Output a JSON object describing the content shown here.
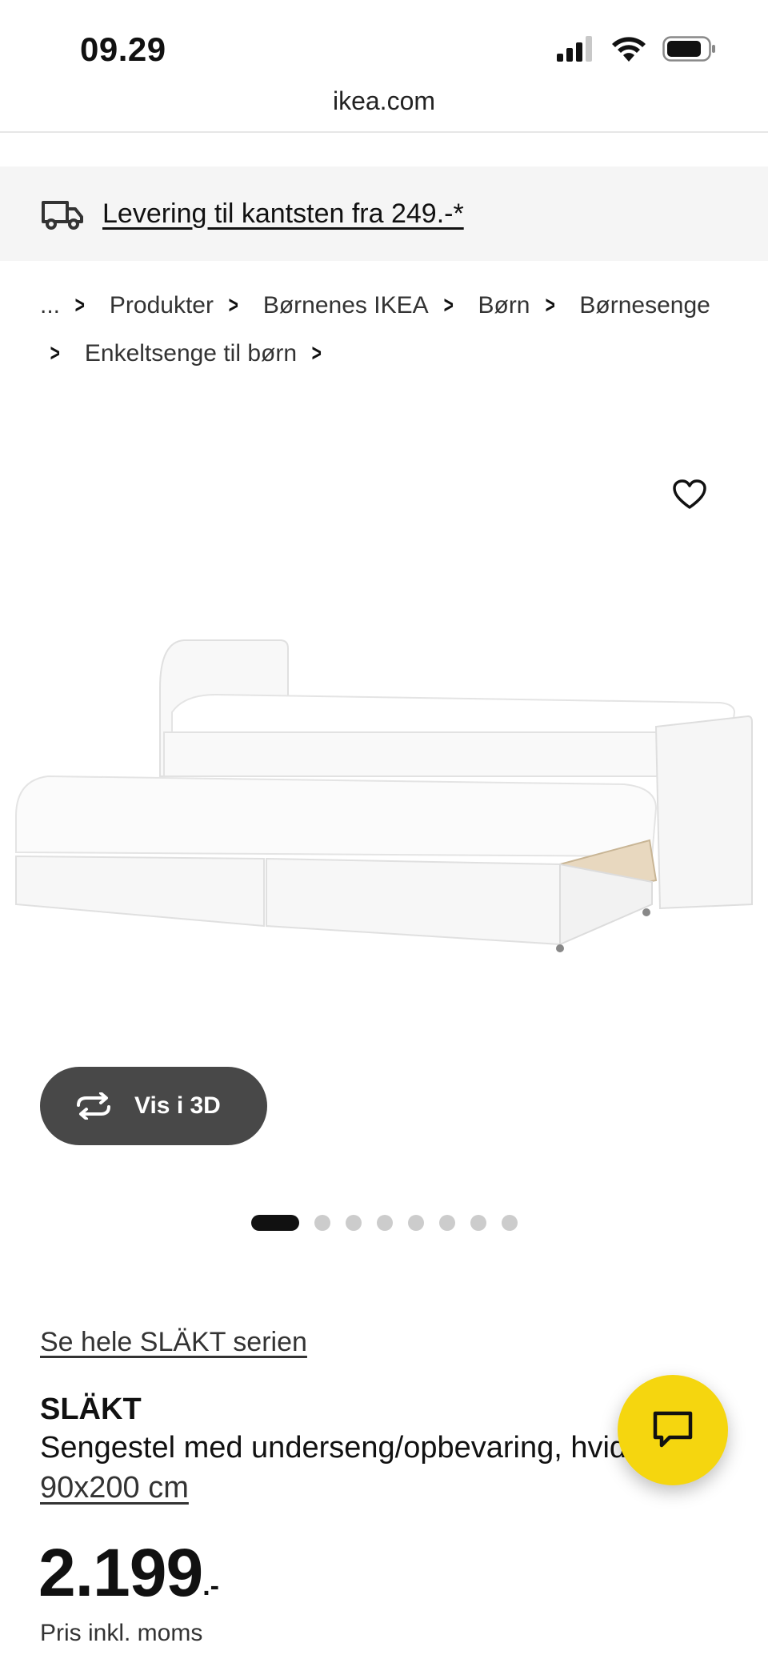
{
  "status_bar": {
    "time": "09.29"
  },
  "browser": {
    "url": "ikea.com"
  },
  "delivery_banner": {
    "text": "Levering til kantsten fra 249.-*",
    "icon": "truck-icon"
  },
  "breadcrumb": {
    "items": [
      "...",
      "Produkter",
      "Børnenes IKEA",
      "Børn",
      "Børnesenge",
      "Enkeltsenge til børn"
    ]
  },
  "favorite": {
    "icon": "heart-icon"
  },
  "view_3d": {
    "label": "Vis i 3D",
    "icon": "rotate-3d-icon"
  },
  "carousel": {
    "total": 8,
    "active_index": 0
  },
  "product": {
    "series_link": "Se hele SLÄKT serien",
    "name": "SLÄKT",
    "description": "Sengestel med underseng/opbevaring, hvid,",
    "size": "90x200 cm",
    "price_integer": "2.199",
    "price_suffix": ".-",
    "vat_note": "Pris inkl. moms"
  },
  "chat": {
    "icon": "chat-bubble-icon"
  },
  "colors": {
    "accent_yellow": "#f5d60f",
    "button_dark": "#484848",
    "banner_bg": "#f5f5f5"
  }
}
